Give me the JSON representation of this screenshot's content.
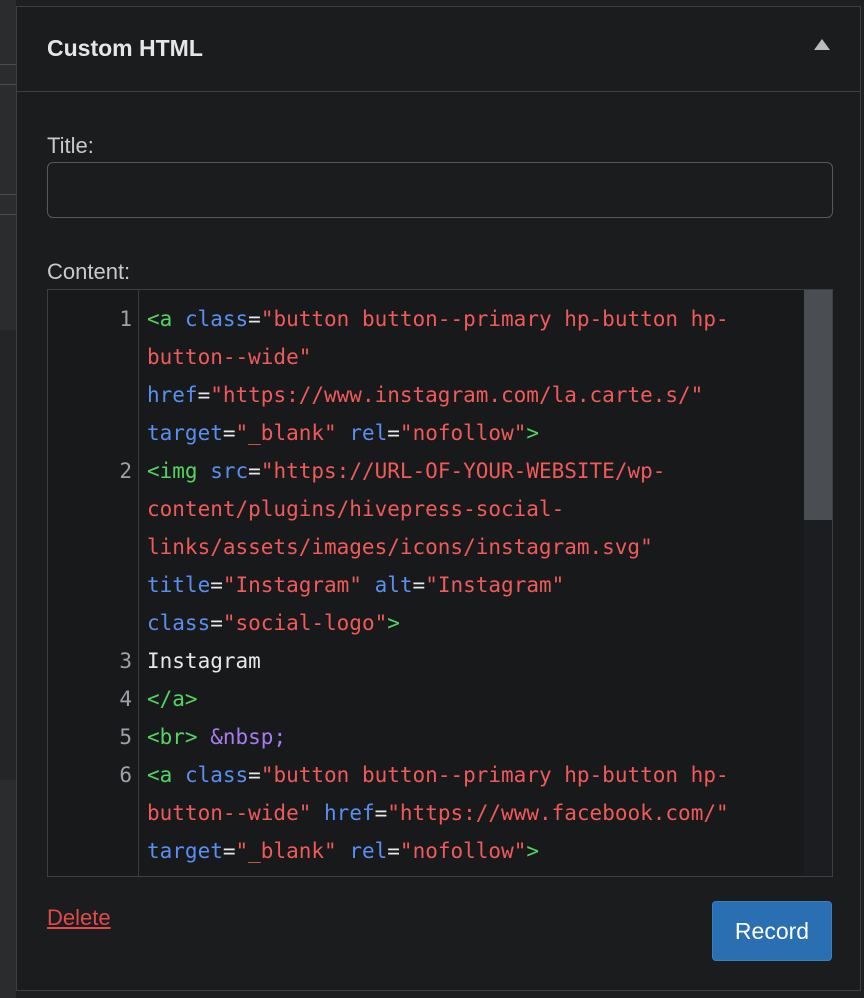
{
  "widget": {
    "title": "Custom HTML",
    "toggle_icon": "triangle-up-icon"
  },
  "form": {
    "title_label": "Title:",
    "title_value": "",
    "content_label": "Content:"
  },
  "editor": {
    "line_numbers": [
      "1",
      "2",
      "3",
      "4",
      "5",
      "6"
    ],
    "rows": [
      [
        [
          "tg",
          "<a "
        ],
        [
          "at",
          "class"
        ],
        [
          "tx",
          "="
        ],
        [
          "st",
          "\"button button--primary hp-button hp-"
        ]
      ],
      [
        [
          "st",
          "button--wide\""
        ]
      ],
      [
        [
          "at",
          "href"
        ],
        [
          "tx",
          "="
        ],
        [
          "st",
          "\"https://www.instagram.com/la.carte.s/\""
        ]
      ],
      [
        [
          "at",
          "target"
        ],
        [
          "tx",
          "="
        ],
        [
          "st",
          "\"_blank\""
        ],
        [
          "tx",
          " "
        ],
        [
          "at",
          "rel"
        ],
        [
          "tx",
          "="
        ],
        [
          "st",
          "\"nofollow\""
        ],
        [
          "tg",
          ">"
        ]
      ],
      [
        [
          "tg",
          "<img "
        ],
        [
          "at",
          "src"
        ],
        [
          "tx",
          "="
        ],
        [
          "st",
          "\"https://URL-OF-YOUR-WEBSITE/wp-"
        ]
      ],
      [
        [
          "st",
          "content/plugins/hivepress-social-"
        ]
      ],
      [
        [
          "st",
          "links/assets/images/icons/instagram.svg\""
        ]
      ],
      [
        [
          "at",
          "title"
        ],
        [
          "tx",
          "="
        ],
        [
          "st",
          "\"Instagram\""
        ],
        [
          "tx",
          " "
        ],
        [
          "at",
          "alt"
        ],
        [
          "tx",
          "="
        ],
        [
          "st",
          "\"Instagram\""
        ]
      ],
      [
        [
          "at",
          "class"
        ],
        [
          "tx",
          "="
        ],
        [
          "st",
          "\"social-logo\""
        ],
        [
          "tg",
          ">"
        ]
      ],
      [
        [
          "tx",
          "Instagram"
        ]
      ],
      [
        [
          "tg",
          "</a>"
        ]
      ],
      [
        [
          "tg",
          "<br>"
        ],
        [
          "tx",
          " "
        ],
        [
          "en",
          "&nbsp;"
        ]
      ],
      [
        [
          "tg",
          "<a "
        ],
        [
          "at",
          "class"
        ],
        [
          "tx",
          "="
        ],
        [
          "st",
          "\"button button--primary hp-button hp-"
        ]
      ],
      [
        [
          "st",
          "button--wide\""
        ],
        [
          "tx",
          " "
        ],
        [
          "at",
          "href"
        ],
        [
          "tx",
          "="
        ],
        [
          "st",
          "\"https://www.facebook.com/\""
        ]
      ],
      [
        [
          "at",
          "target"
        ],
        [
          "tx",
          "="
        ],
        [
          "st",
          "\"_blank\""
        ],
        [
          "tx",
          " "
        ],
        [
          "at",
          "rel"
        ],
        [
          "tx",
          "="
        ],
        [
          "st",
          "\"nofollow\""
        ],
        [
          "tg",
          ">"
        ]
      ]
    ],
    "colors": {
      "tag": "#56d364",
      "attribute": "#5a8ff0",
      "string": "#f05a5a",
      "entity": "#a87cf0",
      "text": "#e8e8e8"
    }
  },
  "actions": {
    "delete_label": "Delete",
    "record_label": "Record"
  }
}
